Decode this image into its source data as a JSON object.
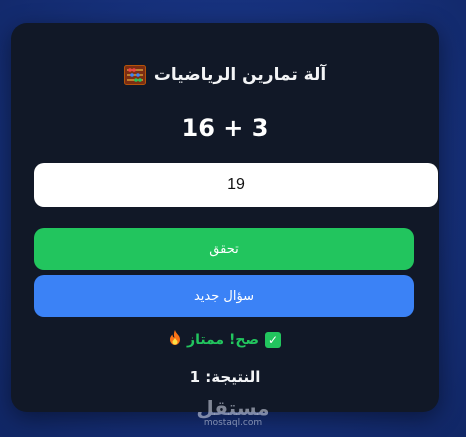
{
  "app": {
    "title": "آلة تمارين الرياضيات",
    "title_icon": "abacus-icon"
  },
  "question": {
    "text": "16 + 3"
  },
  "answer": {
    "value": "19"
  },
  "buttons": {
    "check_label": "تحقق",
    "new_question_label": "سؤال جديد"
  },
  "feedback": {
    "text": "صح! ممتاز",
    "check_icon": "check-mark-icon",
    "fire_icon": "fire-icon"
  },
  "score": {
    "text": "النتيجة: 1"
  },
  "watermark": {
    "logo": "مستقل",
    "sub": "mostaql.com"
  },
  "colors": {
    "background": "#16307a",
    "card": "#111827",
    "success": "#22c55e",
    "primary": "#3b82f6"
  }
}
